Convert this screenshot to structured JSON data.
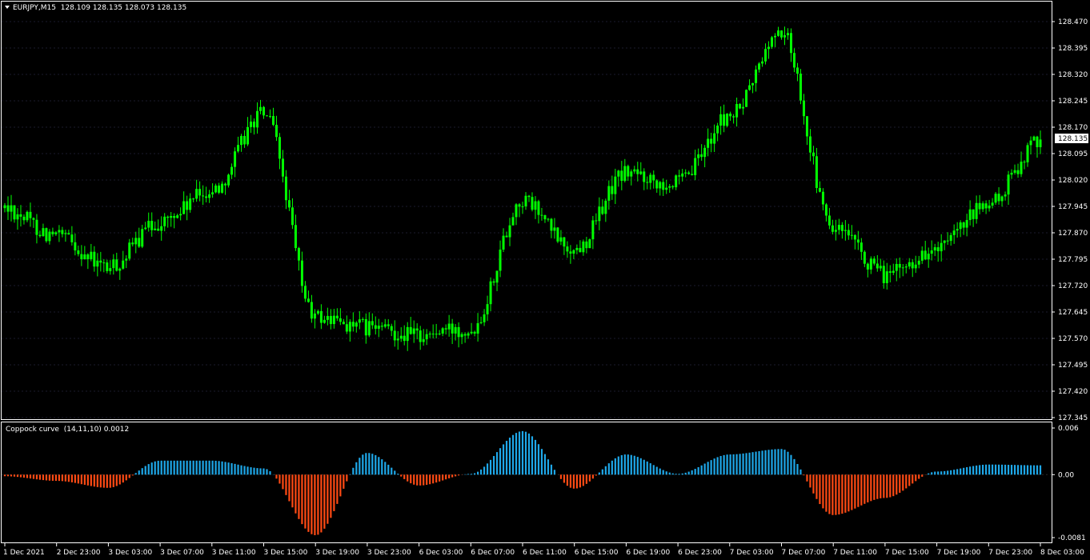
{
  "header": {
    "symbol": "EURJPY,M15",
    "ohlc": "128.109 128.135 128.073 128.135"
  },
  "indicator": {
    "name": "Coppock curve",
    "params": "(14,11,10)",
    "value": "0.0012"
  },
  "price_axis": {
    "ticks": [
      "128.470",
      "128.395",
      "128.320",
      "128.245",
      "128.170",
      "128.095",
      "128.020",
      "127.945",
      "127.870",
      "127.795",
      "127.720",
      "127.645",
      "127.570",
      "127.495",
      "127.420",
      "127.345"
    ],
    "current_price_label": "128.135"
  },
  "indicator_axis": {
    "ticks": [
      "0.006",
      "0.00",
      "-0.0081"
    ]
  },
  "time_axis": {
    "ticks": [
      "1 Dec 2021",
      "2 Dec 23:00",
      "3 Dec 03:00",
      "3 Dec 07:00",
      "3 Dec 11:00",
      "3 Dec 15:00",
      "3 Dec 19:00",
      "3 Dec 23:00",
      "6 Dec 03:00",
      "6 Dec 07:00",
      "6 Dec 11:00",
      "6 Dec 15:00",
      "6 Dec 19:00",
      "6 Dec 23:00",
      "7 Dec 03:00",
      "7 Dec 07:00",
      "7 Dec 11:00",
      "7 Dec 15:00",
      "7 Dec 19:00",
      "7 Dec 23:00",
      "8 Dec 03:00"
    ]
  },
  "colors": {
    "background": "#000000",
    "candle": "#00ff00",
    "hist_positive": "#1ea7e8",
    "hist_negative": "#ff4a14",
    "grid": "#1b1b2e",
    "frame": "#ffffff"
  },
  "chart_data": [
    {
      "type": "candlestick",
      "title": "EURJPY,M15",
      "ylim": [
        127.345,
        128.47
      ],
      "close_path": {
        "x": [
          "1 Dec 2021",
          "2 Dec 23:00",
          "3 Dec 03:00",
          "3 Dec 07:00",
          "3 Dec 11:00",
          "3 Dec 15:00",
          "3 Dec 19:00",
          "3 Dec 23:00",
          "6 Dec 03:00",
          "6 Dec 07:00",
          "6 Dec 11:00",
          "6 Dec 15:00",
          "6 Dec 19:00",
          "6 Dec 23:00",
          "7 Dec 03:00",
          "7 Dec 07:00",
          "7 Dec 11:00",
          "7 Dec 15:00",
          "7 Dec 19:00",
          "7 Dec 23:00",
          "8 Dec 03:00"
        ],
        "y": [
          127.94,
          127.86,
          127.77,
          127.9,
          127.99,
          128.21,
          127.63,
          127.6,
          127.58,
          127.6,
          127.96,
          127.82,
          128.04,
          128.01,
          128.2,
          128.44,
          127.88,
          127.75,
          127.82,
          127.95,
          128.135
        ]
      }
    },
    {
      "type": "bar",
      "title": "Coppock curve (14,11,10)",
      "ylim": [
        -0.0081,
        0.006
      ],
      "x": [
        "1 Dec 2021",
        "2 Dec 23:00",
        "3 Dec 03:00",
        "3 Dec 07:00",
        "3 Dec 11:00",
        "3 Dec 15:00",
        "3 Dec 19:00",
        "3 Dec 23:00",
        "6 Dec 03:00",
        "6 Dec 07:00",
        "6 Dec 11:00",
        "6 Dec 15:00",
        "6 Dec 19:00",
        "6 Dec 23:00",
        "7 Dec 03:00",
        "7 Dec 07:00",
        "7 Dec 11:00",
        "7 Dec 15:00",
        "7 Dec 19:00",
        "7 Dec 23:00",
        "8 Dec 03:00"
      ],
      "values": [
        -0.0002,
        -0.0008,
        -0.0017,
        0.0018,
        0.0018,
        0.0008,
        -0.0078,
        0.0028,
        -0.0014,
        0.0001,
        0.0056,
        -0.0018,
        0.0026,
        0.0001,
        0.0026,
        0.0033,
        -0.0052,
        -0.003,
        0.0004,
        0.0013,
        0.0012
      ]
    }
  ]
}
